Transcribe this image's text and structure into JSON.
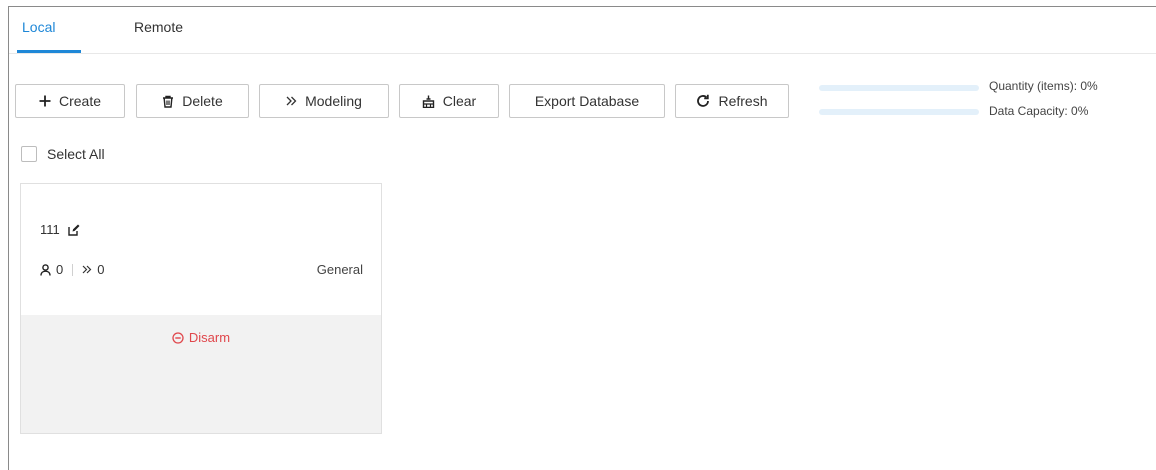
{
  "tabs": [
    {
      "label": "Local",
      "active": true
    },
    {
      "label": "Remote",
      "active": false
    }
  ],
  "toolbar": {
    "create": {
      "label": "Create",
      "icon": "plus-icon"
    },
    "delete": {
      "label": "Delete",
      "icon": "trash-icon"
    },
    "modeling": {
      "label": "Modeling",
      "icon": "double-chevron-icon"
    },
    "clear": {
      "label": "Clear",
      "icon": "clear-icon"
    },
    "export": {
      "label": "Export Database"
    },
    "refresh": {
      "label": "Refresh",
      "icon": "refresh-icon"
    }
  },
  "usage": {
    "quantity": {
      "label": "Quantity (items)",
      "value": "0%",
      "percent": 0
    },
    "capacity": {
      "label": "Data Capacity",
      "value": "0%",
      "percent": 0
    }
  },
  "select_all": {
    "label": "Select All",
    "checked": false
  },
  "cards": [
    {
      "name": "111",
      "person_count": "0",
      "model_count": "0",
      "type": "General",
      "action_label": "Disarm"
    }
  ],
  "colors": {
    "accent": "#1e87d7",
    "danger": "#e0474c",
    "card_footer": "#f2f2f2"
  }
}
